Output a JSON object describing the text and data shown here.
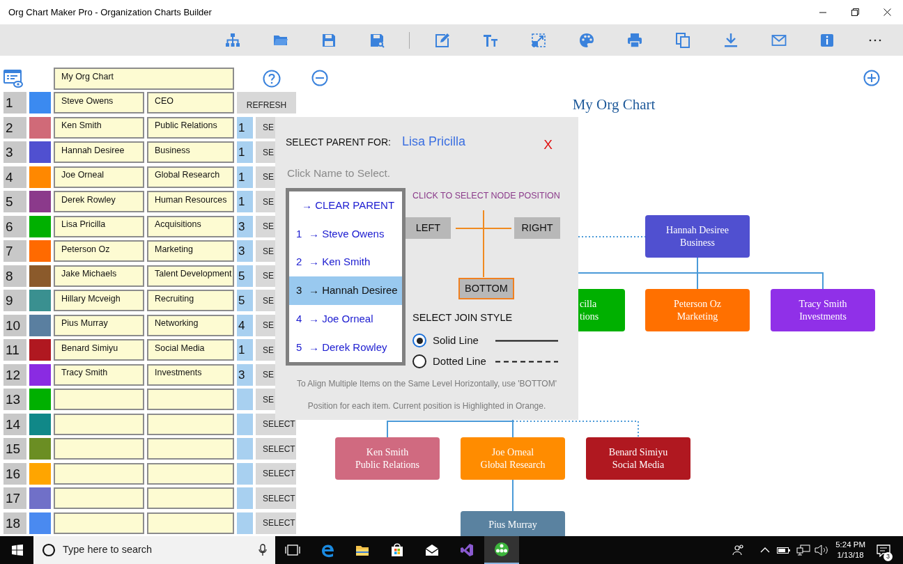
{
  "window": {
    "title": "Org Chart Maker Pro - Organization Charts Builder"
  },
  "editor": {
    "chart_title": "My Org Chart",
    "rows": [
      {
        "kind": "root",
        "number": "1",
        "color": "#3b8af0",
        "name": "Steve Owens",
        "department": "CEO",
        "button": "REFRESH"
      },
      {
        "kind": "child",
        "number": "2",
        "color": "#d06a78",
        "name": "Ken Smith",
        "department": "Public Relations",
        "parent": "1",
        "button": "SE"
      },
      {
        "kind": "child",
        "number": "3",
        "color": "#5050d0",
        "name": "Hannah Desiree",
        "department": "Business",
        "parent": "1",
        "button": "SE"
      },
      {
        "kind": "child",
        "number": "4",
        "color": "#ff8800",
        "name": "Joe Orneal",
        "department": "Global Research",
        "parent": "1",
        "button": "SE"
      },
      {
        "kind": "child",
        "number": "5",
        "color": "#8b3a8b",
        "name": "Derek Rowley",
        "department": "Human Resources",
        "parent": "1",
        "button": "SE"
      },
      {
        "kind": "child",
        "number": "6",
        "color": "#00b000",
        "name": "Lisa Pricilla",
        "department": "Acquisitions",
        "parent": "3",
        "button": "SE"
      },
      {
        "kind": "child",
        "number": "7",
        "color": "#ff6a00",
        "name": "Peterson Oz",
        "department": "Marketing",
        "parent": "3",
        "button": "SE"
      },
      {
        "kind": "child",
        "number": "8",
        "color": "#8b5a2b",
        "name": "Jake Michaels",
        "department": "Talent Development",
        "parent": "5",
        "button": "SE"
      },
      {
        "kind": "child",
        "number": "9",
        "color": "#3a9090",
        "name": "Hillary Mcveigh",
        "department": "Recruiting",
        "parent": "5",
        "button": "SE"
      },
      {
        "kind": "child",
        "number": "10",
        "color": "#5a7fa0",
        "name": "Pius Murray",
        "department": "Networking",
        "parent": "4",
        "button": "SE"
      },
      {
        "kind": "child",
        "number": "11",
        "color": "#b01820",
        "name": "Benard Simiyu",
        "department": "Social Media",
        "parent": "1",
        "button": "SE"
      },
      {
        "kind": "child",
        "number": "12",
        "color": "#8a2be2",
        "name": "Tracy Smith",
        "department": "Investments",
        "parent": "3",
        "button": "SE"
      },
      {
        "kind": "child",
        "number": "13",
        "color": "#00b000",
        "button": "SE"
      },
      {
        "kind": "child",
        "number": "14",
        "color": "#108888",
        "button": "SELECT"
      },
      {
        "kind": "child",
        "number": "15",
        "color": "#6b8e23",
        "button": "SELECT"
      },
      {
        "kind": "child",
        "number": "16",
        "color": "#ffa500",
        "button": "SELECT"
      },
      {
        "kind": "child",
        "number": "17",
        "color": "#7070c8",
        "button": "SELECT"
      },
      {
        "kind": "child",
        "number": "18",
        "color": "#4a8af0",
        "button": "SELECT"
      }
    ]
  },
  "chart": {
    "title": "My Org Chart",
    "nodes": [
      {
        "lines": [
          "Hannah Desiree",
          "Business"
        ],
        "color": "#5050d0"
      },
      {
        "lines": [
          "cilla",
          "tions"
        ],
        "color": "#00b000"
      },
      {
        "lines": [
          "Peterson Oz",
          "Marketing"
        ],
        "color": "#ff7000"
      },
      {
        "lines": [
          "Tracy Smith",
          "Investments"
        ],
        "color": "#9030e8"
      },
      {
        "lines": [
          "Ken Smith",
          "Public Relations"
        ],
        "color": "#d06a80"
      },
      {
        "lines": [
          "Joe Orneal",
          "Global Research"
        ],
        "color": "#ff8c00"
      },
      {
        "lines": [
          "Benard Simiyu",
          "Social Media"
        ],
        "color": "#b01820"
      },
      {
        "lines": [
          "Pius Murray"
        ],
        "color": "#5a82a0"
      }
    ]
  },
  "parent_dialog": {
    "heading": "SELECT PARENT FOR:",
    "person": "Lisa Pricilla",
    "close": "X",
    "hint": "Click Name to Select.",
    "options": [
      {
        "label": "→ CLEAR PARENT",
        "selected": false
      },
      {
        "number": "1",
        "label": "→ Steve Owens",
        "selected": false
      },
      {
        "number": "2",
        "label": "→ Ken Smith",
        "selected": false
      },
      {
        "number": "3",
        "label": "→ Hannah Desiree",
        "selected": true
      },
      {
        "number": "4",
        "label": "→ Joe Orneal",
        "selected": false
      },
      {
        "number": "5",
        "label": "→ Derek Rowley",
        "selected": false
      }
    ],
    "position_title": "CLICK TO SELECT NODE POSITION",
    "positions": [
      {
        "kind": "left",
        "label": "LEFT",
        "selected": false
      },
      {
        "kind": "right",
        "label": "RIGHT",
        "selected": false
      },
      {
        "kind": "bottom",
        "label": "BOTTOM",
        "selected": true
      }
    ],
    "join_title": "SELECT JOIN STYLE",
    "join_styles": [
      {
        "kind": "solid",
        "label": "Solid Line",
        "selected": true
      },
      {
        "kind": "dotted",
        "label": "Dotted Line",
        "selected": false
      }
    ],
    "notes": [
      "To Align Multiple Items on the Same Level Horizontally, use 'BOTTOM'",
      "Position for each item. Current position is Highlighted in Orange."
    ]
  },
  "taskbar": {
    "search_placeholder": "Type here to search",
    "time": "5:24 PM",
    "date": "1/13/18",
    "notifications": "3"
  }
}
